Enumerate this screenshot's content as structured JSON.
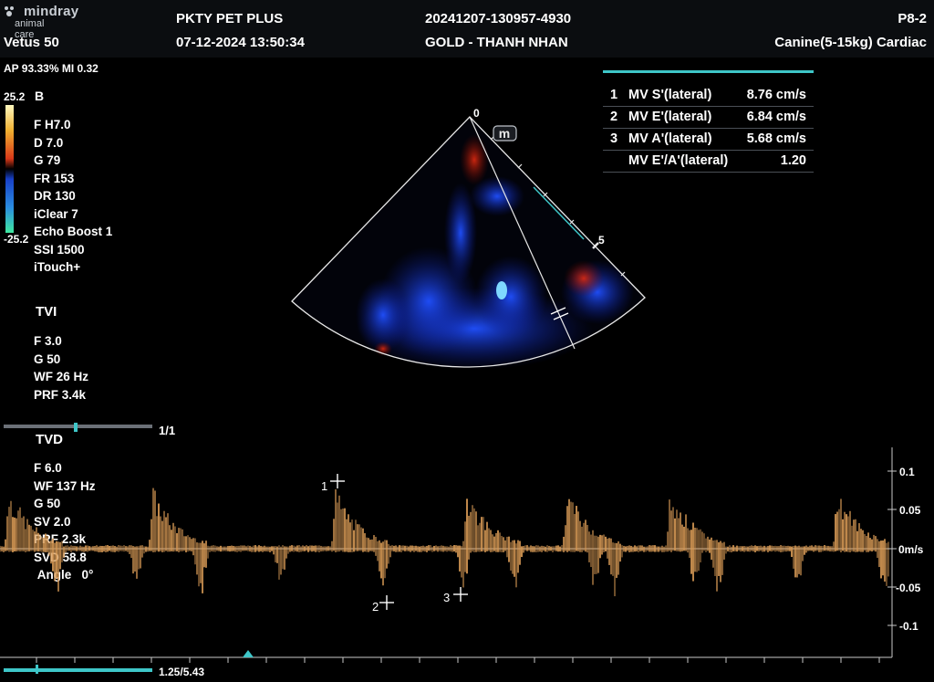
{
  "header": {
    "brand": "mindray",
    "brand_sub": "animal care",
    "device": "Vetus 50",
    "hospital": "PKTY PET PLUS",
    "datetime": "07-12-2024  13:50:34",
    "exam_id": "20241207-130957-4930",
    "patient": "GOLD - THANH NHAN",
    "probe": "P8-2",
    "preset": "Canine(5-15kg) Cardiac"
  },
  "status": {
    "ap_mi": "AP 93.33%  MI 0.32"
  },
  "color_bar": {
    "top_label": "25.2",
    "bottom_label": "-25.2",
    "mode_label": "B"
  },
  "b_params": [
    "F H7.0",
    "D 7.0",
    "G 79",
    "FR 153",
    "DR 130",
    "iClear 7",
    "Echo Boost 1",
    "SSI 1500",
    "iTouch+"
  ],
  "tvi": {
    "title": "TVI",
    "params": [
      "F 3.0",
      "G 50",
      "WF 26 Hz",
      "PRF 3.4k"
    ]
  },
  "cine_top": {
    "label": "1/1"
  },
  "tvd": {
    "title": "TVD",
    "params": [
      "F 6.0",
      "WF 137 Hz",
      "G 50",
      "SV 2.0",
      "PRF 2.3k",
      "SVD 58.8"
    ],
    "angle_label": "Angle",
    "angle_value": "0°"
  },
  "cine_bottom": {
    "label": "1.25/5.43"
  },
  "measurements": [
    {
      "idx": "1",
      "name": "MV S'(lateral)",
      "value": "8.76 cm/s"
    },
    {
      "idx": "2",
      "name": "MV E'(lateral)",
      "value": "6.84 cm/s"
    },
    {
      "idx": "3",
      "name": "MV A'(lateral)",
      "value": "5.68 cm/s"
    },
    {
      "idx": "",
      "name": "MV E'/A'(lateral)",
      "value": "1.20"
    }
  ],
  "sector": {
    "top_depth": "0",
    "side_depth": "5",
    "m_marker": "m"
  },
  "markers": [
    "1",
    "2",
    "3"
  ],
  "velocity_axis": {
    "labels": [
      "0.1",
      "0.05",
      "0m/s",
      "-0.05",
      "-0.1"
    ]
  },
  "colors": {
    "accent": "#3ec6c8",
    "doppler": "#d89a55",
    "bg": "#000000"
  }
}
